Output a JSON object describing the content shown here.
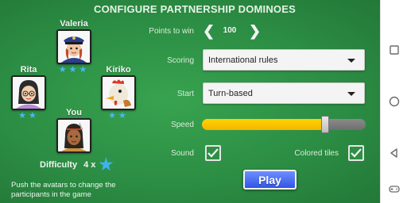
{
  "title": "CONFIGURE  PARTNERSHIP  DOMINOES",
  "players": {
    "top": {
      "name": "Valeria",
      "stars": "★★★",
      "avatar_icon": "police-girl-avatar-icon"
    },
    "left": {
      "name": "Rita",
      "stars": "★★",
      "avatar_icon": "girl-with-glasses-avatar-icon"
    },
    "right": {
      "name": "Kiriko",
      "stars": "★★",
      "avatar_icon": "rooster-avatar-icon"
    },
    "bottom": {
      "name": "You",
      "avatar_icon": "native-girl-avatar-icon"
    }
  },
  "difficulty": {
    "label": "Difficulty",
    "value": "4 x"
  },
  "hint": "Push the avatars to change the participants in the game",
  "points": {
    "label": "Points to win",
    "value": "100",
    "prev": "❮",
    "next": "❯"
  },
  "scoring": {
    "label": "Scoring",
    "value": "International rules"
  },
  "start": {
    "label": "Start",
    "value": "Turn-based"
  },
  "speed": {
    "label": "Speed",
    "level": 0.75
  },
  "sound": {
    "label": "Sound",
    "checked": true
  },
  "colored_tiles": {
    "label": "Colored tiles",
    "checked": true
  },
  "play_label": "Play",
  "colors": {
    "felt": "#2c8e44",
    "accent_star": "#4ab8f0",
    "slider_fill": "#f5b400",
    "play_button": "#2f56e6"
  }
}
